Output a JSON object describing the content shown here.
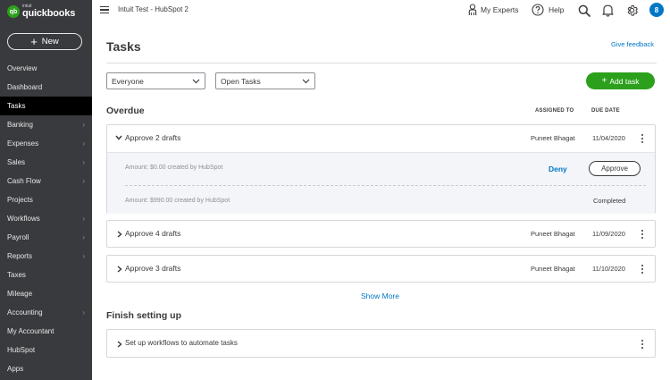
{
  "app": {
    "logo_small": "intuit",
    "logo_main": "quickbooks",
    "logo_badge": "qb"
  },
  "sidebar": {
    "new_label": "New",
    "items": [
      {
        "label": "Overview",
        "chevron": false
      },
      {
        "label": "Dashboard",
        "chevron": false
      },
      {
        "label": "Tasks",
        "chevron": false,
        "active": true
      },
      {
        "label": "Banking",
        "chevron": true
      },
      {
        "label": "Expenses",
        "chevron": true
      },
      {
        "label": "Sales",
        "chevron": true
      },
      {
        "label": "Cash Flow",
        "chevron": true
      },
      {
        "label": "Projects",
        "chevron": false
      },
      {
        "label": "Workflows",
        "chevron": true
      },
      {
        "label": "Payroll",
        "chevron": true
      },
      {
        "label": "Reports",
        "chevron": true
      },
      {
        "label": "Taxes",
        "chevron": false
      },
      {
        "label": "Mileage",
        "chevron": false
      },
      {
        "label": "Accounting",
        "chevron": true
      },
      {
        "label": "My Accountant",
        "chevron": false
      },
      {
        "label": "HubSpot",
        "chevron": false
      },
      {
        "label": "Apps",
        "chevron": false
      }
    ]
  },
  "topbar": {
    "company": "Intuit Test - HubSpot 2",
    "my_experts": "My Experts",
    "help": "Help",
    "icons": [
      "search-icon",
      "bell-icon",
      "gear-icon",
      "avatar"
    ],
    "avatar_initial": "8"
  },
  "page": {
    "title": "Tasks",
    "give_feedback": "Give feedback",
    "filter_assignee": "Everyone",
    "filter_status": "Open Tasks",
    "add_task": "Add task",
    "overdue_title": "Overdue",
    "col_assigned": "ASSIGNED TO",
    "col_due": "DUE DATE",
    "tasks": [
      {
        "title": "Approve 2 drafts",
        "assigned": "Puneet Bhagat",
        "due": "11/04/2020",
        "expanded": true,
        "subitems": [
          {
            "amount": "Amount: $0.00 created by HubSpot",
            "deny": "Deny",
            "approve": "Approve"
          },
          {
            "amount": "Amount: $990.00 created by HubSpot",
            "status": "Completed"
          }
        ]
      },
      {
        "title": "Approve 4 drafts",
        "assigned": "Puneet Bhagat",
        "due": "11/09/2020",
        "expanded": false
      },
      {
        "title": "Approve 3 drafts",
        "assigned": "Puneet Bhagat",
        "due": "11/10/2020",
        "expanded": false
      }
    ],
    "show_more": "Show More",
    "setup_title": "Finish setting up",
    "setup_item": "Set up workflows to automate tasks"
  },
  "colors": {
    "sidebar_bg": "#393a3d",
    "active_bg": "#000000",
    "brand_green": "#2ca01c",
    "link_blue": "#0077c5"
  }
}
